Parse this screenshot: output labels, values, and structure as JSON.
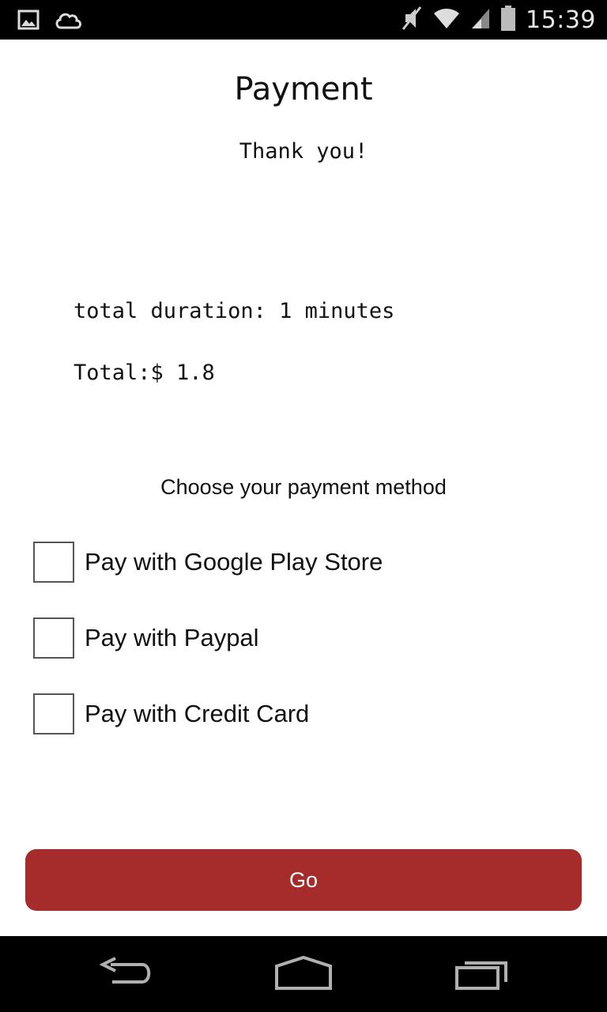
{
  "status_bar": {
    "time": "15:39",
    "left_icons": [
      "image-icon",
      "cloud-icon"
    ],
    "right_icons": [
      "mute-icon",
      "wifi-icon",
      "signal-icon",
      "battery-icon"
    ]
  },
  "screen": {
    "title": "Payment",
    "thank_you": "Thank you!",
    "faded_text": [
      "",
      "",
      ""
    ],
    "duration_text": "total duration: 1 minutes",
    "total_text": "Total:$ 1.8",
    "choose_prompt": "Choose your payment method"
  },
  "payment_options": [
    {
      "label": "Pay with Google Play Store",
      "checked": false
    },
    {
      "label": "Pay with Paypal",
      "checked": false
    },
    {
      "label": "Pay with Credit Card",
      "checked": false
    }
  ],
  "go_button": {
    "label": "Go"
  },
  "nav_bar": {
    "icons": [
      "back-icon",
      "home-icon",
      "recent-apps-icon"
    ]
  },
  "colors": {
    "accent": "#a62b2b",
    "status_bar_bg": "#000000",
    "nav_bar_bg": "#000000"
  }
}
